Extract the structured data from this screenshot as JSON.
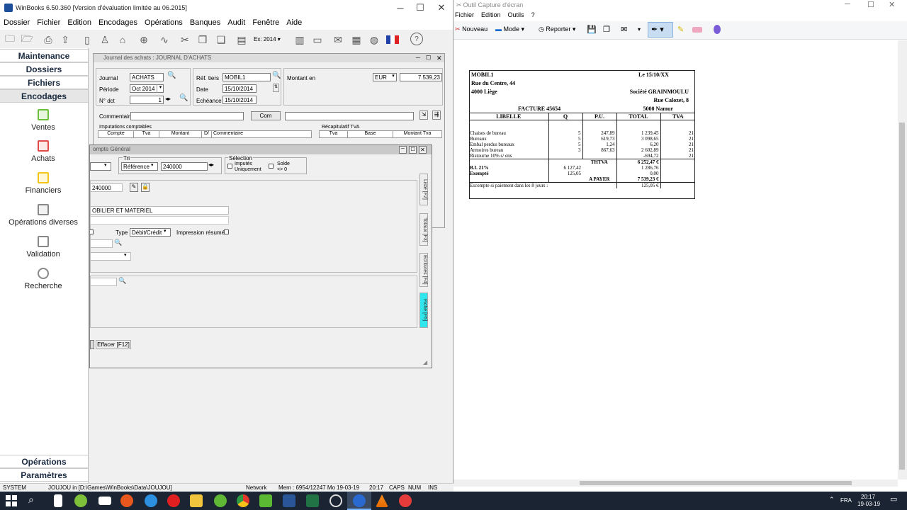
{
  "winbooks": {
    "title": "WinBooks 6.50.360 [Version d'évaluation limitée au 06.2015]",
    "menu": [
      "Dossier",
      "Fichier",
      "Edition",
      "Encodages",
      "Opérations",
      "Banques",
      "Audit",
      "Fenêtre",
      "Aide"
    ],
    "exercise": "Ex: 2014",
    "sidebar": {
      "top_sections": [
        "Maintenance",
        "Dossiers",
        "Fichiers",
        "Encodages"
      ],
      "items": [
        "Ventes",
        "Achats",
        "Financiers",
        "Opérations diverses",
        "Validation",
        "Recherche"
      ],
      "bottom_sections": [
        "Opérations",
        "Paramètres"
      ]
    },
    "journal": {
      "title": "Journal des achats : JOURNAL D'ACHATS",
      "journal_label": "Journal",
      "journal_value": "ACHATS",
      "periode_label": "Période",
      "periode_value": "Oct 2014",
      "ndct_label": "N° dct",
      "ndct_value": "1",
      "ref_label": "Réf. tiers",
      "ref_value": "MOBIL1",
      "date_label": "Date",
      "date_value": "15/10/2014",
      "echeance_label": "Echéance",
      "echeance_value": "15/10/2014",
      "montant_label": "Montant en",
      "currency": "EUR",
      "montant_value": "7.539,23",
      "commentaire_label": "Commentaire",
      "com_button": "Com",
      "imputations_label": "Imputations comptables",
      "imputations_cols": [
        "Compte",
        "Tva",
        "Montant",
        "D/",
        "Commentaire"
      ],
      "recap_label": "Récapitulatif TVA",
      "recap_cols": [
        "Tva",
        "Base",
        "Montant Tva"
      ]
    },
    "compte": {
      "title": "ompte Général",
      "tri_label": "Tri",
      "tri_value": "Référence",
      "tri_search": "240000",
      "selection_label": "Sélection",
      "imputes_label": "Imputés Uniquement",
      "solde_label": "Solde <> 0",
      "account_value": "240000",
      "account_name": "OBILIER ET MATERIEL",
      "type_label": "Type",
      "type_value": "Débit/Crédit",
      "impression_label": "Impression résumée",
      "effacer_button": "Effacer [F12]",
      "tabs": [
        "Liste [F2]",
        "Totaux [F3]",
        "Ecritures [F4]",
        "Fiche [F5]"
      ]
    },
    "status": {
      "user": "SYSTEM",
      "path": "JOUJOU in [D:\\Games\\WinBooks\\Data\\JOUJOU]",
      "network": "Network",
      "mem": "Mem : 6954/12247 Mo",
      "date": "19-03-19",
      "time": "20:17",
      "caps": "CAPS",
      "num": "NUM",
      "ins": "INS"
    }
  },
  "snip": {
    "title": "Outil Capture d'écran",
    "menu": [
      "Fichier",
      "Edition",
      "Outils",
      "?"
    ],
    "nouveau": "Nouveau",
    "mode": "Mode",
    "reporter": "Reporter"
  },
  "invoice": {
    "vendor_name": "MOBIL1",
    "vendor_street": "Rue du Centre, 44",
    "vendor_city": "4000 Liège",
    "date": "Le 15/10/XX",
    "client_name": "Société GRAINMOULU",
    "client_street": "Rue Calozet, 8",
    "client_city": "5000 Namur",
    "facture": "FACTURE 45654",
    "headers": [
      "LIBELLE",
      "Q",
      "P.U.",
      "TOTAL",
      "TVA"
    ],
    "lines": [
      {
        "libelle": "Chaises de bureau",
        "q": "5",
        "pu": "247,89",
        "total": "1 239,45",
        "tva": "21"
      },
      {
        "libelle": "Bureaux",
        "q": "5",
        "pu": "619,73",
        "total": "3 098,65",
        "tva": "21"
      },
      {
        "libelle": "Embal perdus bureaux",
        "q": "5",
        "pu": "1,24",
        "total": "6,20",
        "tva": "21"
      },
      {
        "libelle": "Armoires bureau",
        "q": "3",
        "pu": "867,63",
        "total": "2 602,89",
        "tva": "21"
      },
      {
        "libelle": "Ristourne 10% s/ ens",
        "q": "",
        "pu": "",
        "total": "-694,72",
        "tva": "21"
      }
    ],
    "bi_label": "B.I. 21%",
    "bi_base": "6 127,42",
    "exempt_label": "Exempté",
    "exempt_base": "125,05",
    "thtva_label": "THTVA",
    "thtva": "6 252,47 €",
    "tva_amount": "1 286,76",
    "exempt_amount": "0,00",
    "payer_label": "A PAYER",
    "payer": "7 539,23 €",
    "escompte_label": "Escompte si paiement dans les 8 jours :",
    "escompte": "125,05 €"
  },
  "taskbar": {
    "lang": "FRA",
    "time": "20:17",
    "date": "19-03-19"
  }
}
